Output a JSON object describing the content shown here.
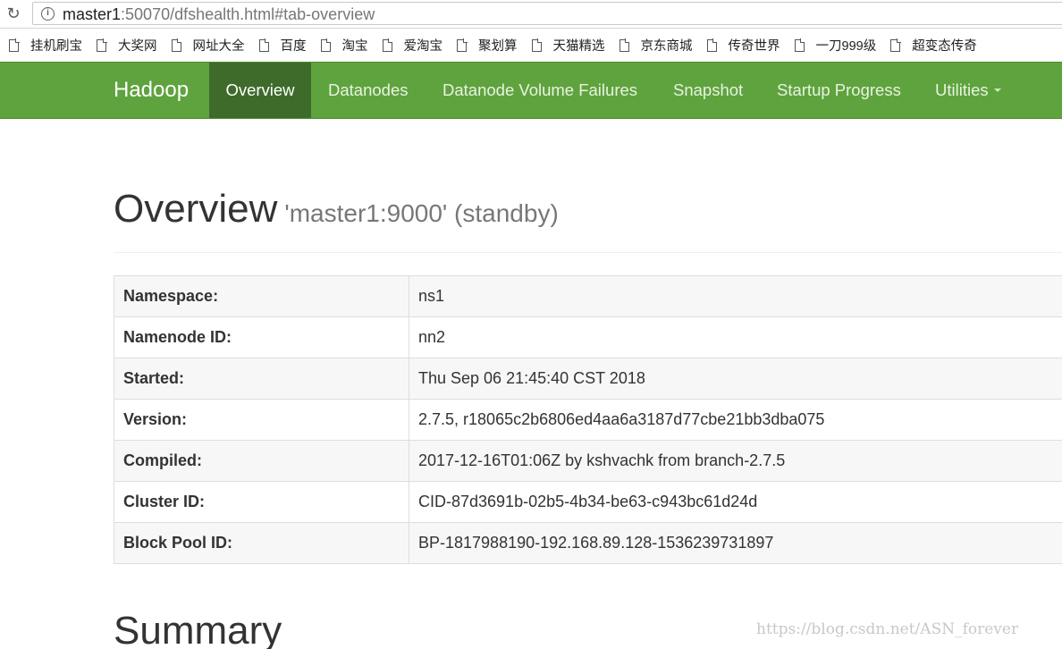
{
  "browser": {
    "url_host": "master1",
    "url_rest": ":50070/dfshealth.html#tab-overview"
  },
  "bookmarks": [
    "挂机刷宝",
    "大奖网",
    "网址大全",
    "百度",
    "淘宝",
    "爱淘宝",
    "聚划算",
    "天猫精选",
    "京东商城",
    "传奇世界",
    "一刀999级",
    "超变态传奇"
  ],
  "navbar": {
    "brand": "Hadoop",
    "items": [
      {
        "label": "Overview",
        "active": true
      },
      {
        "label": "Datanodes",
        "active": false
      },
      {
        "label": "Datanode Volume Failures",
        "active": false
      },
      {
        "label": "Snapshot",
        "active": false
      },
      {
        "label": "Startup Progress",
        "active": false
      },
      {
        "label": "Utilities",
        "active": false,
        "dropdown": true
      }
    ]
  },
  "overview": {
    "title": "Overview",
    "subtitle": "'master1:9000' (standby)",
    "rows": [
      {
        "key": "Namespace:",
        "value": "ns1"
      },
      {
        "key": "Namenode ID:",
        "value": "nn2"
      },
      {
        "key": "Started:",
        "value": "Thu Sep 06 21:45:40 CST 2018"
      },
      {
        "key": "Version:",
        "value": "2.7.5, r18065c2b6806ed4aa6a3187d77cbe21bb3dba075"
      },
      {
        "key": "Compiled:",
        "value": "2017-12-16T01:06Z by kshvachk from branch-2.7.5"
      },
      {
        "key": "Cluster ID:",
        "value": "CID-87d3691b-02b5-4b34-be63-c943bc61d24d"
      },
      {
        "key": "Block Pool ID:",
        "value": "BP-1817988190-192.168.89.128-1536239731897"
      }
    ]
  },
  "summary": {
    "title": "Summary"
  },
  "watermark": "https://blog.csdn.net/ASN_forever",
  "colors": {
    "navbar": "#5fa33e",
    "navbar_active": "#3e6b2a"
  }
}
